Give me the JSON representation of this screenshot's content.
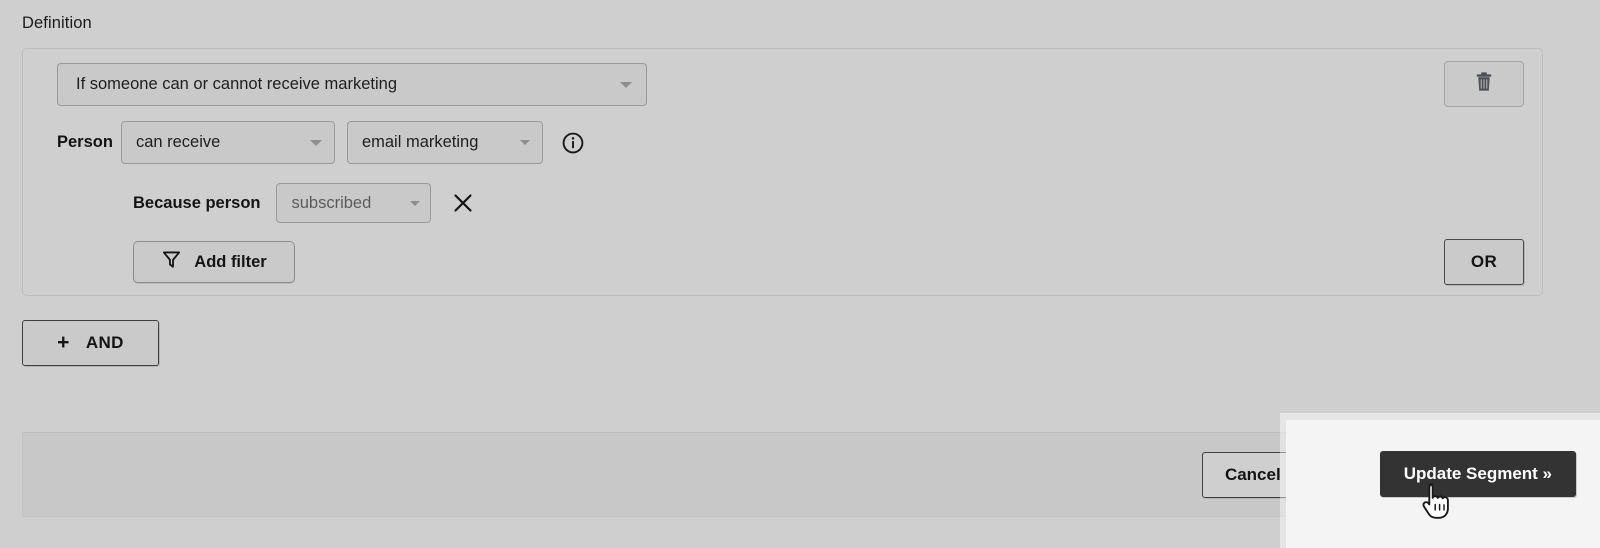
{
  "section": {
    "label": "Definition"
  },
  "definition": {
    "type_select": {
      "value": "If someone can or cannot receive marketing",
      "icon": "chevron-down-icon"
    },
    "person_row": {
      "label": "Person",
      "operator_select": {
        "value": "can receive"
      },
      "channel_select": {
        "value": "email marketing"
      },
      "info_icon": "info-circle-icon"
    },
    "because_row": {
      "label": "Because person",
      "reason_select": {
        "value": "subscribed"
      },
      "remove_icon": "close-x-icon"
    },
    "add_filter": {
      "label": "Add filter",
      "icon": "filter-funnel-icon"
    },
    "delete_group": {
      "icon": "trash-icon",
      "label": ""
    },
    "or_button": {
      "label": "OR"
    }
  },
  "and_button": {
    "label": "AND",
    "icon": "plus-icon"
  },
  "footer": {
    "cancel_label": "Cancel",
    "submit_label": "Update Segment »"
  },
  "colors": {
    "page_background": "#cfcfcf",
    "card_border": "#bdbdbd",
    "control_background": "#c9c9c9",
    "control_border": "#9a9a9a",
    "primary_button_background": "#333333",
    "primary_button_text": "#ffffff",
    "text": "#1a1a1a",
    "muted_text": "#5c5c5c",
    "focus_overlay": "#f4f4f4"
  },
  "cursor": {
    "icon": "pointing-hand-cursor"
  }
}
